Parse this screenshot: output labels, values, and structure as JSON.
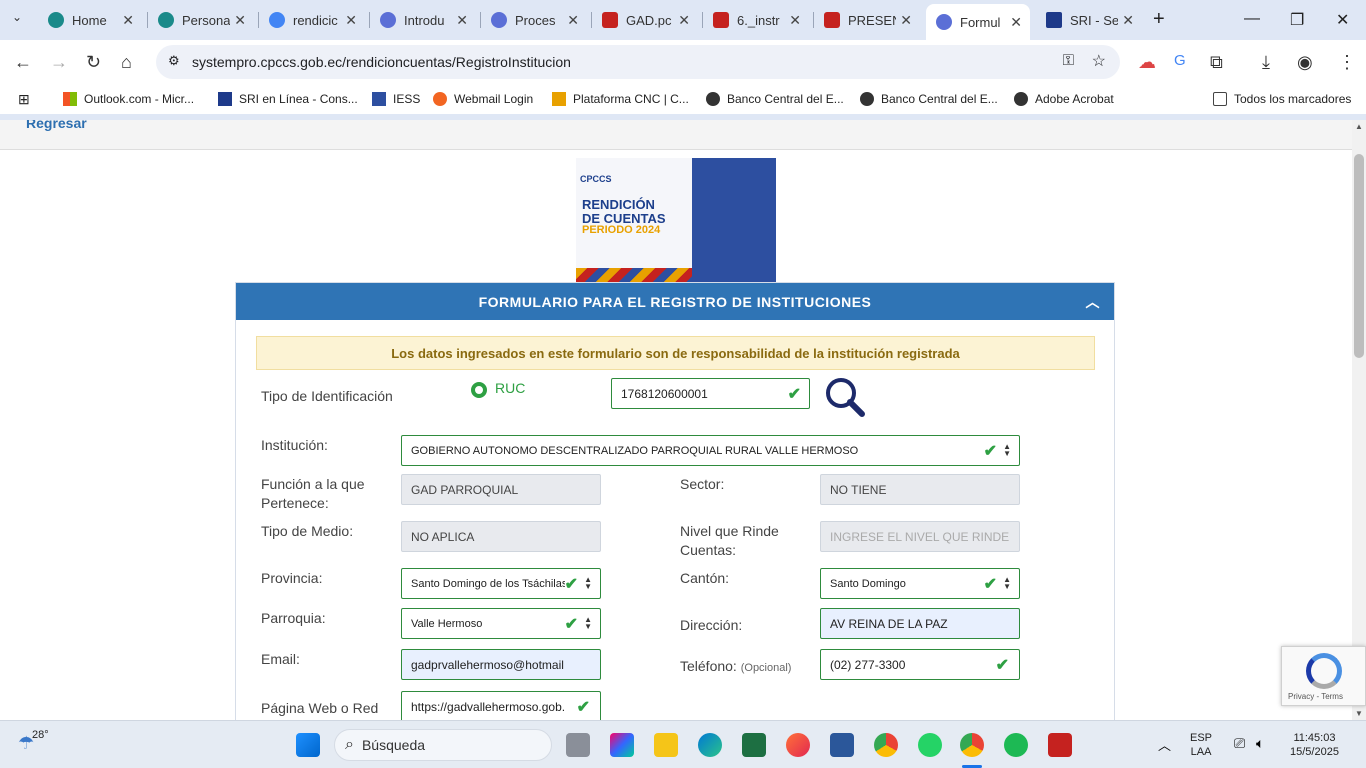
{
  "browser": {
    "tabs": [
      {
        "label": "Home",
        "color": "#1a73e8"
      },
      {
        "label": "Persona",
        "color": "#1a8a8a"
      },
      {
        "label": "rendicic",
        "color": "#4285f4"
      },
      {
        "label": "Introdu",
        "color": "#5b6fd6"
      },
      {
        "label": "Proces",
        "color": "#5b6fd6"
      },
      {
        "label": "GAD.pc",
        "color": "#c5221f"
      },
      {
        "label": "6._instr",
        "color": "#c5221f"
      },
      {
        "label": "PRESEN",
        "color": "#c5221f"
      },
      {
        "label": "Formul",
        "color": "#5b6fd6"
      },
      {
        "label": "SRI - Se",
        "color": "#1e3a8a"
      }
    ],
    "url": "systempro.cpccs.gob.ec/rendicioncuentas/RegistroInstitucion",
    "bookmarks": [
      "Outlook.com - Micr...",
      "SRI en Línea - Cons...",
      "IESS",
      "Webmail Login",
      "Plataforma CNC | C...",
      "Banco Central del E...",
      "Banco Central del E...",
      "Adobe Acrobat"
    ],
    "all_bookmarks": "Todos los marcadores"
  },
  "page": {
    "back_link": "Regresar",
    "banner": {
      "line1": "RENDICIÓN",
      "line2": "DE CUENTAS",
      "line3": "PERIODO 2024",
      "org": "CPCCS"
    },
    "form": {
      "title": "FORMULARIO PARA EL REGISTRO DE INSTITUCIONES",
      "notice": "Los datos ingresados en este formulario son de responsabilidad de la institución registrada",
      "tipo_id_label": "Tipo de Identificación",
      "tipo_id_option": "RUC",
      "ruc_value": "1768120600001",
      "institucion_label": "Institución:",
      "institucion_value": "GOBIERNO AUTONOMO DESCENTRALIZADO PARROQUIAL RURAL VALLE HERMOSO",
      "funcion_label_1": "Función a la que",
      "funcion_label_2": "Pertenece:",
      "funcion_value": "GAD PARROQUIAL",
      "sector_label": "Sector:",
      "sector_value": "NO TIENE",
      "tipo_medio_label": "Tipo de Medio:",
      "tipo_medio_value": "NO APLICA",
      "nivel_label_1": "Nivel que Rinde",
      "nivel_label_2": "Cuentas:",
      "nivel_placeholder": "INGRESE EL NIVEL QUE RINDE",
      "provincia_label": "Provincia:",
      "provincia_value": "Santo Domingo de los Tsáchilas",
      "canton_label": "Cantón:",
      "canton_value": "Santo Domingo",
      "parroquia_label": "Parroquia:",
      "parroquia_value": "Valle Hermoso",
      "direccion_label": "Dirección:",
      "direccion_value": "AV REINA DE LA PAZ",
      "email_label": "Email:",
      "email_value": "gadprvallehermoso@hotmail",
      "telefono_label": "Teléfono:",
      "telefono_optional": "(Opcional)",
      "telefono_value": "(02) 277-3300",
      "pagina_label": "Página Web o Red",
      "pagina_value": "https://gadvallehermoso.gob."
    },
    "recaptcha_text": "Privacy - Terms"
  },
  "taskbar": {
    "weather": "28°",
    "search_placeholder": "Búsqueda",
    "lang1": "ESP",
    "lang2": "LAA",
    "time": "11:45:03",
    "date": "15/5/2025"
  }
}
